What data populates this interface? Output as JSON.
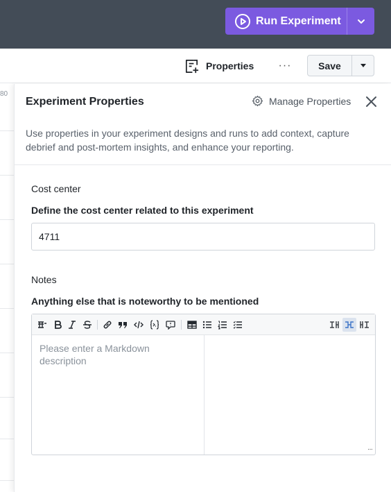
{
  "header": {
    "run_label": "Run Experiment",
    "accent_color": "#7b5ae0",
    "bar_color": "#434c57"
  },
  "toolbar": {
    "properties_label": "Properties",
    "more_label": "···",
    "save_label": "Save"
  },
  "background": {
    "column_number": "80"
  },
  "panel": {
    "title": "Experiment Properties",
    "manage_label": "Manage Properties",
    "intro": "Use properties in your experiment designs and runs to add context, capture debrief and post-mortem insights, and enhance your reporting."
  },
  "fields": {
    "cost_center": {
      "title": "Cost center",
      "description": "Define the cost center related to this experiment",
      "value": "4711"
    },
    "notes": {
      "title": "Notes",
      "description": "Anything else that is noteworthy to be mentioned",
      "placeholder": "Please enter a Markdown description",
      "resize_label": "···"
    }
  },
  "editor_tools": [
    "heading-icon",
    "bold-icon",
    "italic-icon",
    "strikethrough-icon",
    "link-icon",
    "quote-icon",
    "code-icon",
    "code-block-icon",
    "comment-icon",
    "table-icon",
    "bullet-list-icon",
    "numbered-list-icon",
    "task-list-icon",
    "edit-mode-icon",
    "split-mode-icon",
    "preview-mode-icon"
  ]
}
